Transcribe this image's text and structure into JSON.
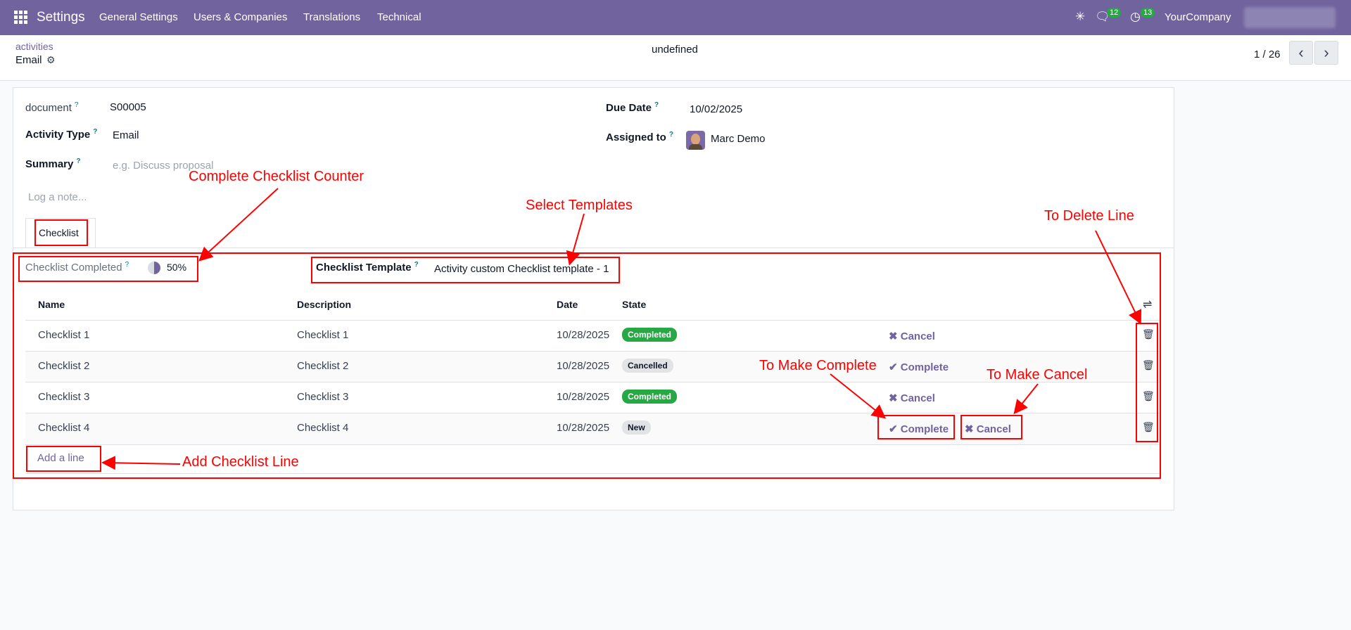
{
  "topbar": {
    "app": "Settings",
    "menu": [
      "General Settings",
      "Users & Companies",
      "Translations",
      "Technical"
    ],
    "bug_icon": "bug-icon",
    "chat_icon": "chat-icon",
    "chat_count": "12",
    "activity_icon": "clock-icon",
    "activity_count": "13",
    "company": "YourCompany"
  },
  "control_panel": {
    "breadcrumb_parent": "activities",
    "breadcrumb_current": "Email",
    "center_text": "undefined",
    "pager": "1 / 26"
  },
  "form": {
    "document_label": "document",
    "document_value": "S00005",
    "activity_type_label": "Activity Type",
    "activity_type_value": "Email",
    "summary_label": "Summary",
    "summary_placeholder": "e.g. Discuss proposal",
    "note_placeholder": "Log a note...",
    "due_date_label": "Due Date",
    "due_date_value": "10/02/2025",
    "assigned_label": "Assigned to",
    "assigned_value": "Marc Demo",
    "tab_label": "Checklist",
    "progress_label": "Checklist Completed",
    "progress_value": "50%",
    "progress_fraction": 0.5,
    "template_label": "Checklist Template",
    "template_value": "Activity custom Checklist template - 1"
  },
  "table": {
    "columns": [
      "Name",
      "Description",
      "Date",
      "State"
    ],
    "rows": [
      {
        "name": "Checklist 1",
        "description": "Checklist 1",
        "date": "10/28/2025",
        "state": "Completed",
        "actions": [
          "Cancel"
        ]
      },
      {
        "name": "Checklist 2",
        "description": "Checklist 2",
        "date": "10/28/2025",
        "state": "Cancelled",
        "actions": [
          "Complete"
        ]
      },
      {
        "name": "Checklist 3",
        "description": "Checklist 3",
        "date": "10/28/2025",
        "state": "Completed",
        "actions": [
          "Cancel"
        ]
      },
      {
        "name": "Checklist 4",
        "description": "Checklist 4",
        "date": "10/28/2025",
        "state": "New",
        "actions": [
          "Complete",
          "Cancel"
        ]
      }
    ],
    "add_line": "Add a line"
  },
  "annotations": {
    "counter": "Complete Checklist Counter",
    "templates": "Select Templates",
    "delete_line": "To Delete Line",
    "make_complete": "To Make Complete",
    "make_cancel": "To Make Cancel",
    "add_line": "Add Checklist Line"
  },
  "colors": {
    "brand": "#71639e",
    "annotation": "#ff0000",
    "completed": "#28a745"
  }
}
